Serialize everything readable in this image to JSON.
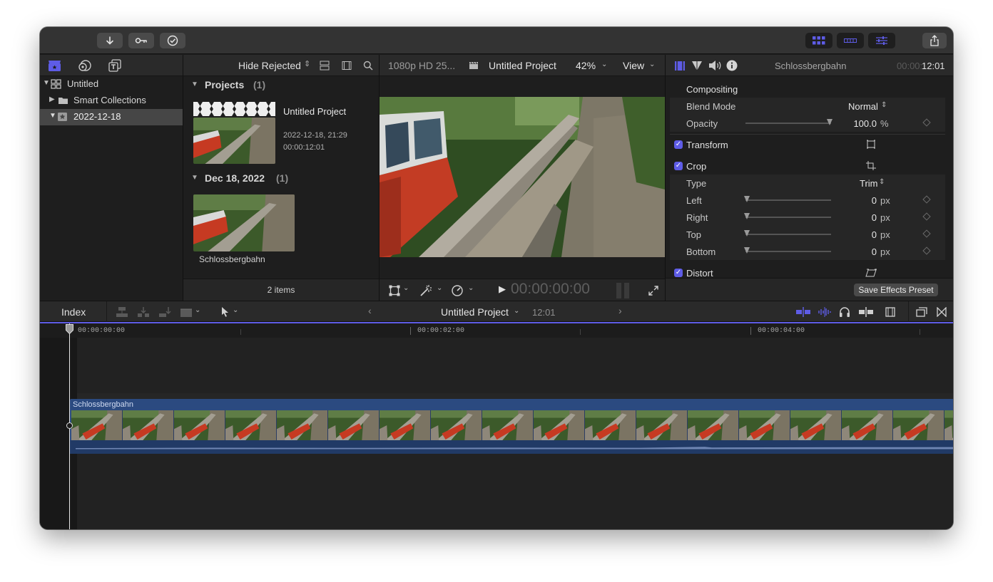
{
  "colors": {
    "accent": "#5e5ce6",
    "clip_blue": "#2b4a80",
    "close": "#ff5f57",
    "minimize": "#febc2e",
    "zoom": "#28c840"
  },
  "toolbar": {
    "import_icon": "arrow-down-icon",
    "keywords_icon": "key-icon",
    "background_tasks_icon": "checkmark-circle-icon",
    "share_icon": "share-icon"
  },
  "library": {
    "items": [
      {
        "label": "Untitled",
        "icon": "library-icon",
        "expanded": true
      },
      {
        "label": "Smart Collections",
        "icon": "folder-icon",
        "expanded": false
      },
      {
        "label": "2022-12-18",
        "icon": "event-star-icon",
        "expanded": true,
        "selected": true
      }
    ]
  },
  "browser": {
    "filter_label": "Hide Rejected",
    "sections": [
      {
        "title": "Projects",
        "count": "(1)"
      },
      {
        "title": "Dec 18, 2022",
        "count": "(1)"
      }
    ],
    "project": {
      "name": "Untitled Project",
      "date": "2022-12-18, 21:29",
      "duration": "00:00:12:01"
    },
    "clip": {
      "name": "Schlossbergbahn"
    },
    "footer": "2 items"
  },
  "viewer": {
    "format": "1080p HD 25...",
    "project_name": "Untitled Project",
    "zoom": "42%",
    "view_label": "View",
    "timecode": "00:00:00:00"
  },
  "inspector": {
    "clip_name": "Schlossbergbahn",
    "timecode_dim": "00:00:",
    "timecode_bright": "12:01",
    "compositing": {
      "title": "Compositing",
      "blend_mode_label": "Blend Mode",
      "blend_mode_value": "Normal",
      "opacity_label": "Opacity",
      "opacity_value": "100.0",
      "opacity_unit": "%",
      "opacity_level": 1.0
    },
    "transform_label": "Transform",
    "crop": {
      "label": "Crop",
      "type_label": "Type",
      "type_value": "Trim",
      "rows": [
        {
          "label": "Left",
          "value": "0",
          "unit": "px"
        },
        {
          "label": "Right",
          "value": "0",
          "unit": "px"
        },
        {
          "label": "Top",
          "value": "0",
          "unit": "px"
        },
        {
          "label": "Bottom",
          "value": "0",
          "unit": "px"
        }
      ]
    },
    "distort_label": "Distort",
    "save_preset_label": "Save Effects Preset"
  },
  "timeline": {
    "index_label": "Index",
    "project_name": "Untitled Project",
    "duration": "12:01",
    "ruler": [
      "00:00:00:00",
      "00:00:02:00",
      "00:00:04:00"
    ],
    "clip_label": "Schlossbergbahn"
  }
}
